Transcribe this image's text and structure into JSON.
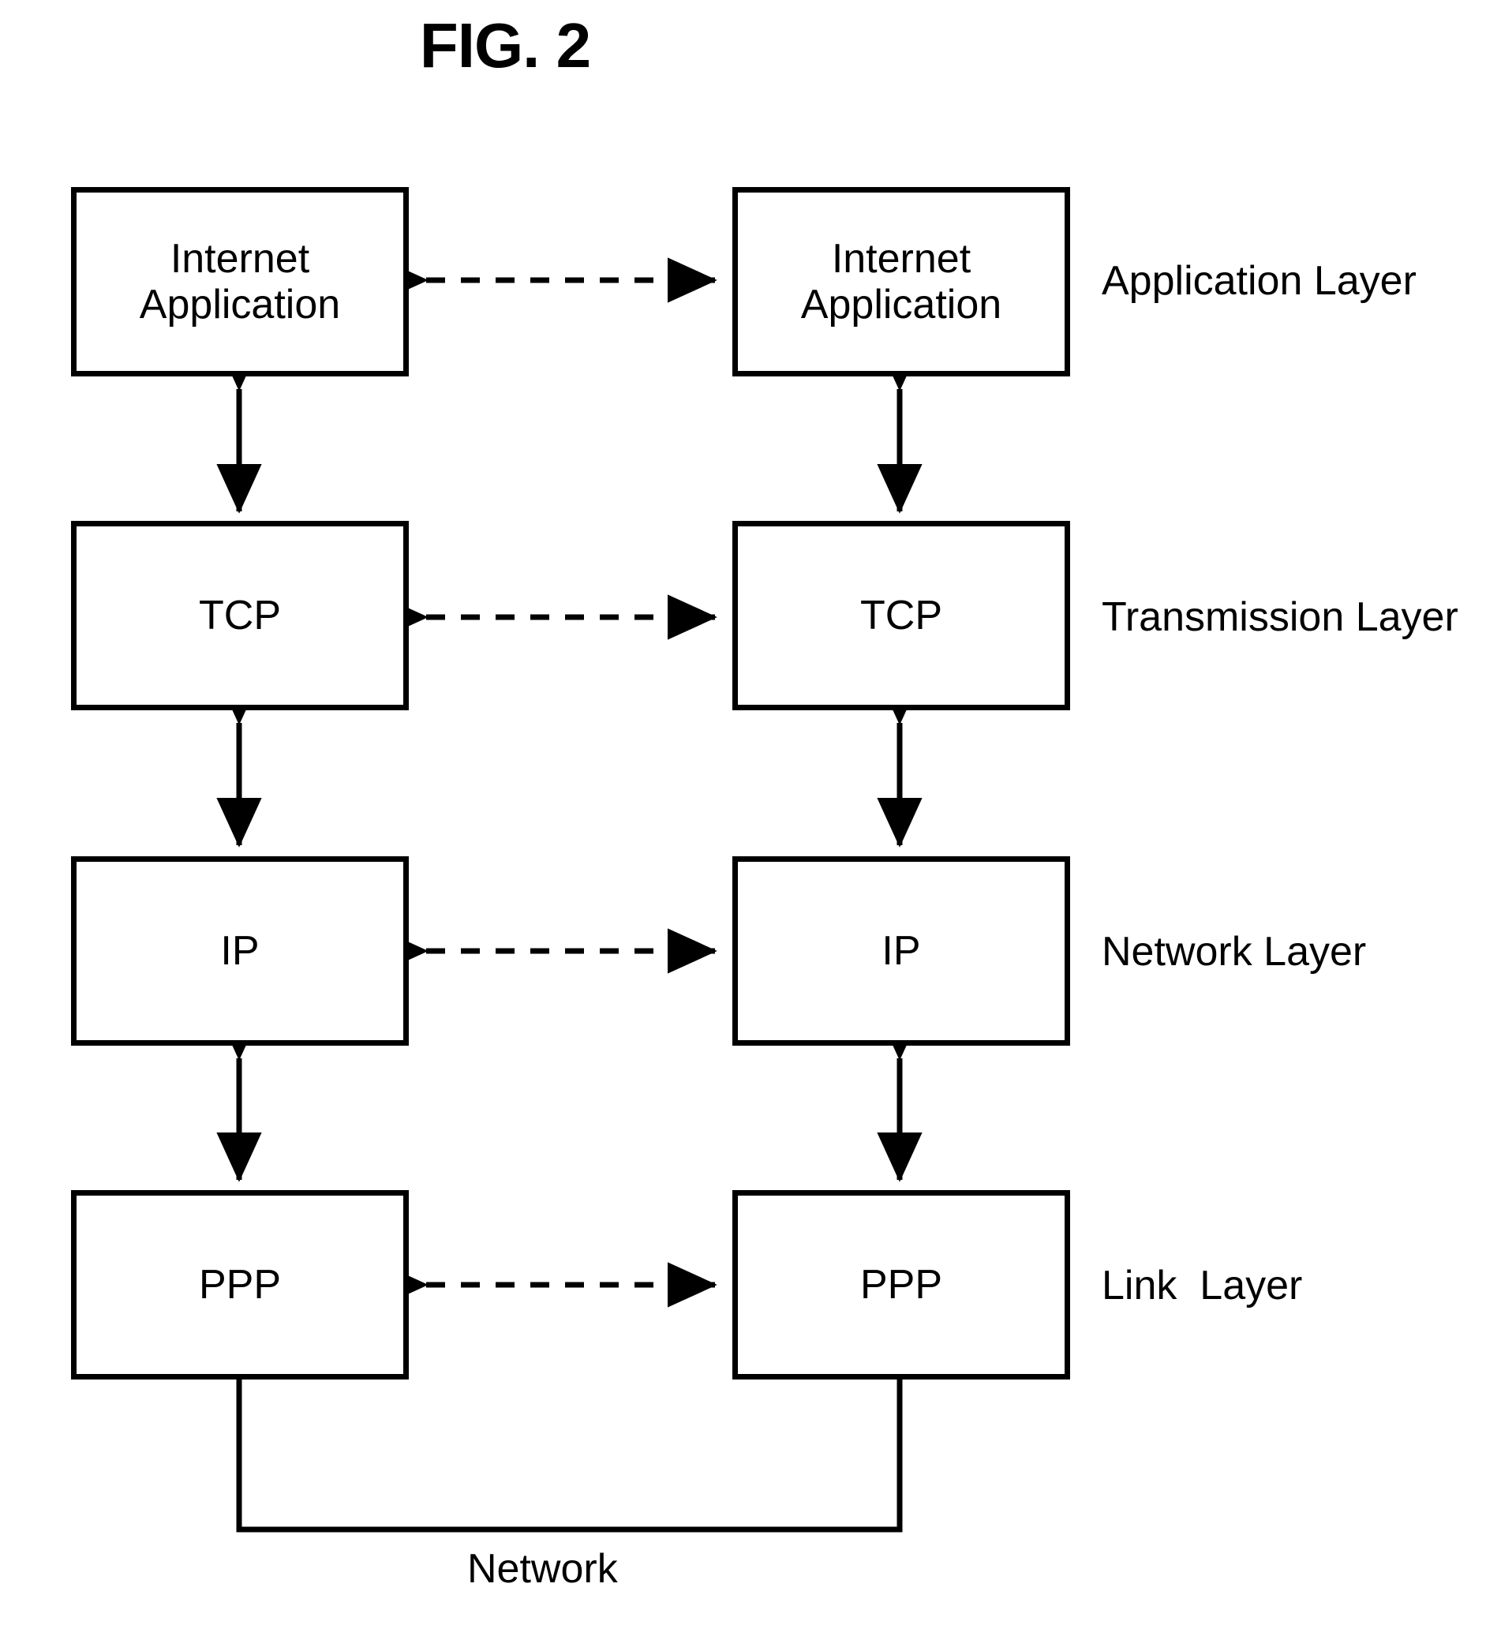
{
  "figure": {
    "title": "FIG. 2",
    "network_label": "Network"
  },
  "stacks": {
    "left": {
      "name": "left-protocol-stack",
      "boxes": [
        {
          "id": "left-application",
          "label": "Internet\nApplication"
        },
        {
          "id": "left-tcp",
          "label": "TCP"
        },
        {
          "id": "left-ip",
          "label": "IP"
        },
        {
          "id": "left-ppp",
          "label": "PPP"
        }
      ]
    },
    "right": {
      "name": "right-protocol-stack",
      "boxes": [
        {
          "id": "right-application",
          "label": "Internet\nApplication"
        },
        {
          "id": "right-tcp",
          "label": "TCP"
        },
        {
          "id": "right-ip",
          "label": "IP"
        },
        {
          "id": "right-ppp",
          "label": "PPP"
        }
      ]
    }
  },
  "layer_labels": [
    {
      "id": "application-layer",
      "label": "Application Layer"
    },
    {
      "id": "transmission-layer",
      "label": "Transmission Layer"
    },
    {
      "id": "network-layer",
      "label": "Network Layer"
    },
    {
      "id": "link-layer",
      "label": "Link  Layer"
    }
  ],
  "connectors": {
    "peer_links": [
      {
        "id": "application-peer-link",
        "style": "dashed",
        "direction": "bidirectional"
      },
      {
        "id": "tcp-peer-link",
        "style": "dashed",
        "direction": "bidirectional"
      },
      {
        "id": "ip-peer-link",
        "style": "dashed",
        "direction": "bidirectional"
      },
      {
        "id": "ppp-peer-link",
        "style": "dashed",
        "direction": "bidirectional"
      }
    ],
    "stack_links": [
      {
        "id": "left-application-tcp-link",
        "style": "solid",
        "direction": "bidirectional"
      },
      {
        "id": "left-tcp-ip-link",
        "style": "solid",
        "direction": "bidirectional"
      },
      {
        "id": "left-ip-ppp-link",
        "style": "solid",
        "direction": "bidirectional"
      },
      {
        "id": "right-application-tcp-link",
        "style": "solid",
        "direction": "bidirectional"
      },
      {
        "id": "right-tcp-ip-link",
        "style": "solid",
        "direction": "bidirectional"
      },
      {
        "id": "right-ip-ppp-link",
        "style": "solid",
        "direction": "bidirectional"
      }
    ],
    "network_bus": {
      "id": "network-bus",
      "style": "solid",
      "direction": "none"
    }
  },
  "colors": {
    "stroke": "#000000",
    "background": "#ffffff",
    "text": "#000000"
  }
}
